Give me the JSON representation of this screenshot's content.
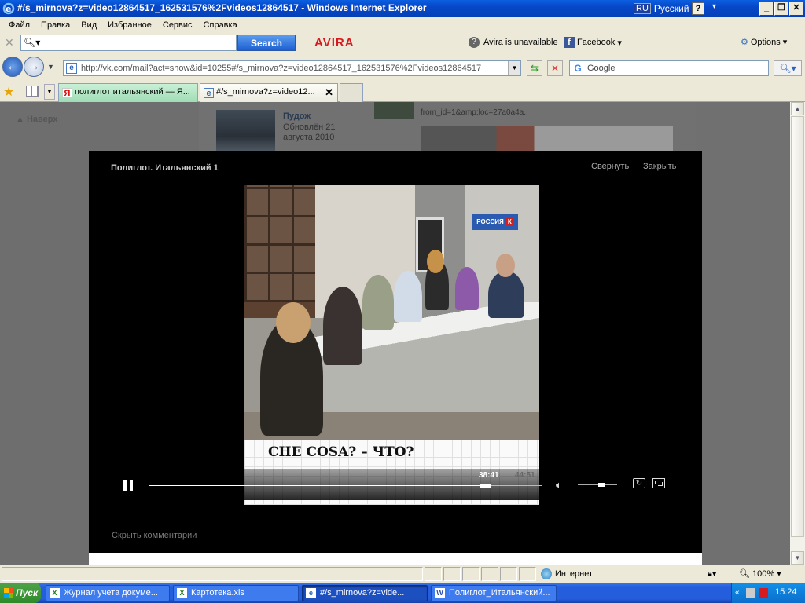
{
  "window": {
    "title": "#/s_mirnova?z=video12864517_162531576%2Fvideos12864517 - Windows Internet Explorer",
    "lang_code": "RU",
    "lang_name": "Русский",
    "help": "?"
  },
  "menu": [
    "Файл",
    "Правка",
    "Вид",
    "Избранное",
    "Сервис",
    "Справка"
  ],
  "toolbar": {
    "search_placeholder": "",
    "search_label": "Search",
    "avira_brand": "AVIRA",
    "avira_status": "Avira is unavailable",
    "facebook_label": "Facebook",
    "options_label": "Options"
  },
  "address": {
    "url": "http://vk.com/mail?act=show&id=10255#/s_mirnova?z=video12864517_162531576%2Fvideos12864517",
    "search_placeholder": "Google"
  },
  "tabs": [
    {
      "label": "полиглот итальянский — Я..."
    },
    {
      "label": "#/s_mirnova?z=video12..."
    }
  ],
  "page": {
    "back_to_top": "Наверх",
    "feed_title": "Пудож",
    "feed_updated": "Обновлён 21 августа 2010",
    "snippet": "from_id=1&amp;loc=27a0a4a.."
  },
  "video": {
    "title": "Полиглот. Итальянский 1",
    "collapse_label": "Свернуть",
    "close_label": "Закрыть",
    "channel_badge": "РОССИЯ",
    "channel_badge_k": "К",
    "caption": "CHE COSA? – ЧТО?",
    "time_current": "38:41",
    "time_total": "44:51",
    "progress": 0.855,
    "volume": 0.6,
    "hide_comments": "Скрыть комментарии"
  },
  "status": {
    "zone": "Интернет",
    "zoom": "100%"
  },
  "taskbar": {
    "start": "Пуск",
    "tasks": [
      "Журнал учета докуме...",
      "Картотека.xls",
      "#/s_mirnova?z=vide...",
      "Полиглот_Итальянский..."
    ],
    "clock": "15:24"
  },
  "colors": {
    "accent": "#245edc",
    "overlay_bg": "#000000",
    "avira_red": "#d71920"
  }
}
